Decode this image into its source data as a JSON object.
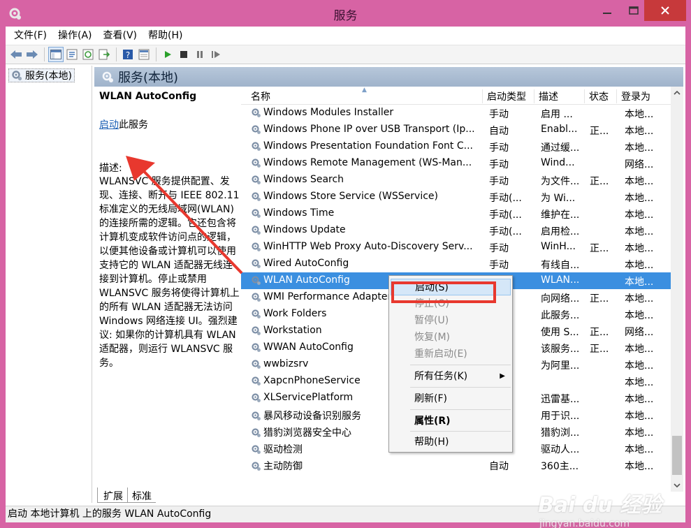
{
  "window": {
    "title": "服务"
  },
  "menubar": {
    "items": [
      "文件(F)",
      "操作(A)",
      "查看(V)",
      "帮助(H)"
    ]
  },
  "toolbar": {
    "icons": [
      "back-arrow-icon",
      "forward-arrow-icon",
      "show-tree-icon",
      "properties-icon",
      "refresh-icon",
      "export-icon",
      "help-icon",
      "console-view-icon",
      "play-icon",
      "stop-icon",
      "pause-icon",
      "resume-icon"
    ]
  },
  "tree": {
    "root_label": "服务(本地)"
  },
  "panel": {
    "title": "服务(本地)"
  },
  "detail": {
    "service_name": "WLAN AutoConfig",
    "start_link": "启动",
    "start_suffix": "此服务",
    "description_label": "描述:",
    "description_text": "WLANSVC 服务提供配置、发现、连接、断开与 IEEE 802.11 标准定义的无线局域网(WLAN)的连接所需的逻辑。它还包含将计算机变成软件访问点的逻辑，以便其他设备或计算机可以使用支持它的 WLAN 适配器无线连接到计算机。停止或禁用 WLANSVC 服务将使得计算机上的所有 WLAN 适配器无法访问 Windows 网络连接 UI。强烈建议: 如果你的计算机具有 WLAN 适配器，则运行 WLANSVC 服务。"
  },
  "columns": {
    "name": "名称",
    "startup": "启动类型",
    "desc": "描述",
    "state": "状态",
    "logon": "登录为"
  },
  "rows": [
    {
      "name": "Windows Modules Installer",
      "startup": "手动",
      "desc": "启用 ...",
      "state": "",
      "logon": "本地..."
    },
    {
      "name": "Windows Phone IP over USB Transport (Ip...",
      "startup": "自动",
      "desc": "Enabl...",
      "state": "正...",
      "logon": "本地..."
    },
    {
      "name": "Windows Presentation Foundation Font C...",
      "startup": "手动",
      "desc": "通过缓...",
      "state": "",
      "logon": "本地..."
    },
    {
      "name": "Windows Remote Management (WS-Man...",
      "startup": "手动",
      "desc": "Wind...",
      "state": "",
      "logon": "网络..."
    },
    {
      "name": "Windows Search",
      "startup": "手动",
      "desc": "为文件...",
      "state": "正...",
      "logon": "本地..."
    },
    {
      "name": "Windows Store Service (WSService)",
      "startup": "手动(...",
      "desc": "为 Wi...",
      "state": "",
      "logon": "本地..."
    },
    {
      "name": "Windows Time",
      "startup": "手动(...",
      "desc": "维护在...",
      "state": "",
      "logon": "本地..."
    },
    {
      "name": "Windows Update",
      "startup": "手动(...",
      "desc": "启用检...",
      "state": "",
      "logon": "本地..."
    },
    {
      "name": "WinHTTP Web Proxy Auto-Discovery Serv...",
      "startup": "手动",
      "desc": "WinH...",
      "state": "正...",
      "logon": "本地..."
    },
    {
      "name": "Wired AutoConfig",
      "startup": "手动",
      "desc": "有线自...",
      "state": "",
      "logon": "本地..."
    },
    {
      "name": "WLAN AutoConfig",
      "startup": "",
      "desc": "WLAN...",
      "state": "",
      "logon": "本地...",
      "selected": true
    },
    {
      "name": "WMI Performance Adapter",
      "startup": "",
      "desc": "向网络...",
      "state": "正...",
      "logon": "本地..."
    },
    {
      "name": "Work Folders",
      "startup": "",
      "desc": "此服务...",
      "state": "",
      "logon": "本地..."
    },
    {
      "name": "Workstation",
      "startup": "",
      "desc": "使用 S...",
      "state": "正...",
      "logon": "网络..."
    },
    {
      "name": "WWAN AutoConfig",
      "startup": "",
      "desc": "该服务...",
      "state": "正...",
      "logon": "本地..."
    },
    {
      "name": "wwbizsrv",
      "startup": "",
      "desc": "为阿里...",
      "state": "",
      "logon": "本地..."
    },
    {
      "name": "XapcnPhoneService",
      "startup": "",
      "desc": "",
      "state": "",
      "logon": "本地..."
    },
    {
      "name": "XLServicePlatform",
      "startup": "",
      "desc": "迅雷基...",
      "state": "",
      "logon": "本地..."
    },
    {
      "name": "暴风移动设备识别服务",
      "startup": "",
      "desc": "用于识...",
      "state": "",
      "logon": "本地..."
    },
    {
      "name": "猎豹浏览器安全中心",
      "startup": "",
      "desc": "猎豹浏...",
      "state": "",
      "logon": "本地..."
    },
    {
      "name": "驱动检测",
      "startup": "",
      "desc": "驱动人...",
      "state": "",
      "logon": "本地..."
    },
    {
      "name": "主动防御",
      "startup": "自动",
      "desc": "360主...",
      "state": "",
      "logon": "本地..."
    }
  ],
  "context_menu": {
    "start": "启动(S)",
    "stop": "停止(O)",
    "pause": "暂停(U)",
    "resume": "恢复(M)",
    "restart": "重新启动(E)",
    "all_tasks": "所有任务(K)",
    "refresh": "刷新(F)",
    "properties": "属性(R)",
    "help": "帮助(H)"
  },
  "tabs": {
    "extended": "扩展",
    "standard": "标准"
  },
  "statusbar": {
    "text": "启动 本地计算机 上的服务 WLAN AutoConfig"
  },
  "watermark": {
    "brand": "Bai du 经验",
    "url": "jingyan.baidu.com"
  },
  "colors": {
    "titlebar": "#d763a4",
    "selection": "#3b8fe0",
    "annotation": "#e8382e",
    "link": "#1b5fb4"
  }
}
